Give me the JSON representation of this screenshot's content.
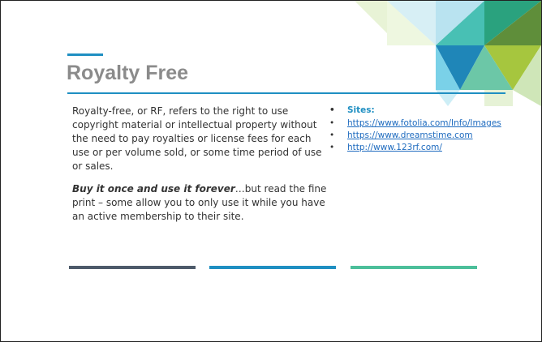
{
  "slide": {
    "title": "Royalty Free",
    "paragraph_1": "Royalty-free, or RF, refers to the right to use copyright material or intellectual property without the need to pay royalties or license fees for each use or per volume sold, or some time period of use or sales.",
    "paragraph_2_emphasis": "Buy it once and use it forever",
    "paragraph_2_rest": "…but read the fine print – some allow you to only use it while you have an active membership to their site.",
    "sites_heading": "Sites:",
    "links": [
      "https://www.fotolia.com/Info/Images",
      "https://www.dreamstime.com",
      "http://www.123rf.com/"
    ],
    "bullet_glyph": "•"
  },
  "colors": {
    "title": "#8b8b8b",
    "accent_blue": "#1f8fc2",
    "bar_slate": "#4d5a6a",
    "bar_green": "#4cbf9a",
    "link": "#1e6bbf"
  }
}
